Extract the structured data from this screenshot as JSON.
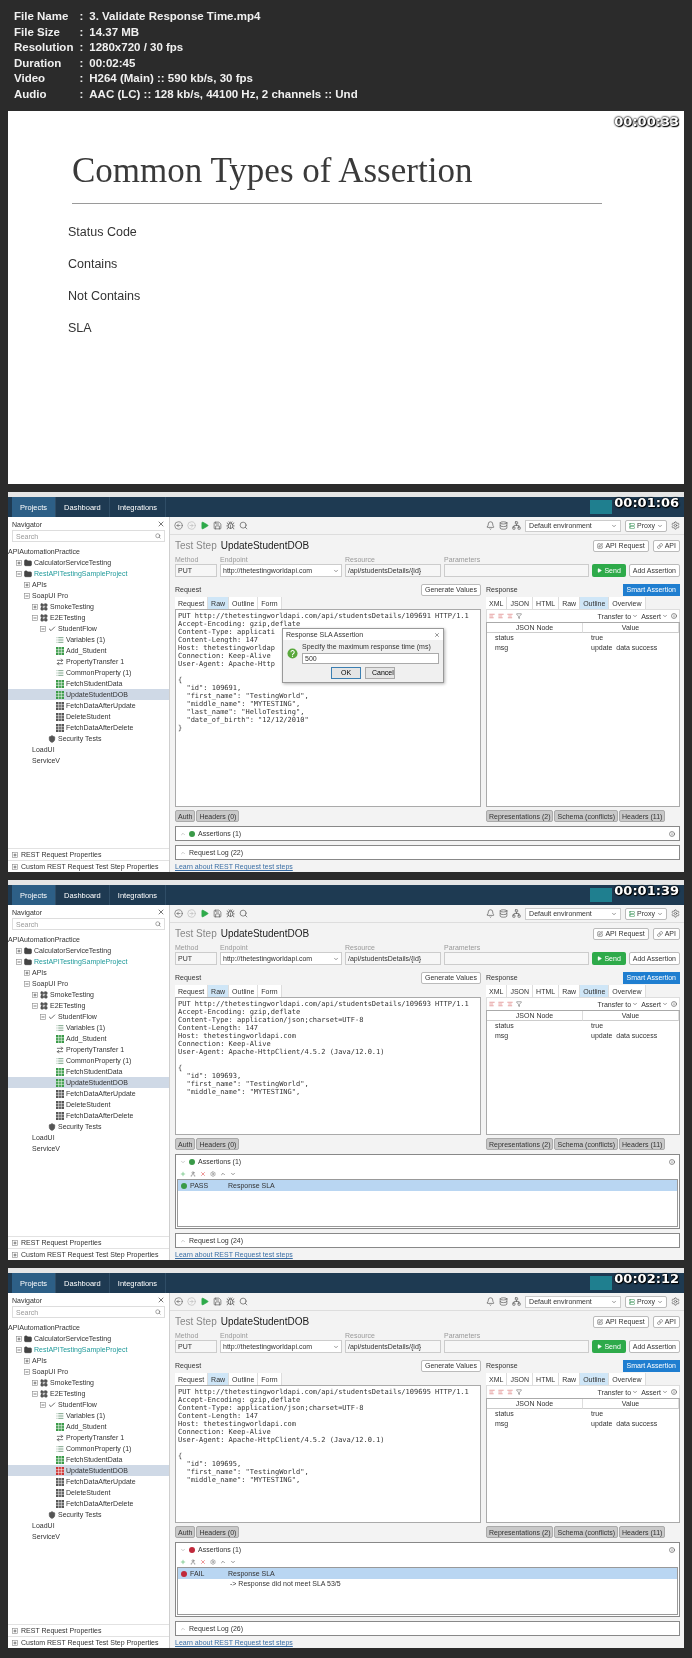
{
  "info": [
    {
      "label": "File Name",
      "sep": ":",
      "value": "3. Validate Response Time.mp4"
    },
    {
      "label": "File Size",
      "sep": ":",
      "value": "14.37 MB"
    },
    {
      "label": "Resolution",
      "sep": ":",
      "value": "1280x720 / 30 fps"
    },
    {
      "label": "Duration",
      "sep": ":",
      "value": "00:02:45"
    },
    {
      "label": "Video",
      "sep": ":",
      "value": "H264 (Main) :: 590 kb/s, 30 fps"
    },
    {
      "label": "Audio",
      "sep": ":",
      "value": "AAC (LC) :: 128 kb/s, 44100 Hz, 2 channels :: Und"
    }
  ],
  "frames": [
    {
      "kind": "slide",
      "timestamp": "00:00:33",
      "title": "Common Types of Assertion",
      "items": [
        "Status Code",
        "Contains",
        "Not Contains",
        "SLA"
      ]
    },
    {
      "kind": "app",
      "timestamp": "00:01:06",
      "tabs": [
        {
          "label": "Projects",
          "selected": true
        },
        {
          "label": "Dashboard",
          "selected": false
        },
        {
          "label": "Integrations",
          "selected": false
        }
      ],
      "navigator": {
        "title": "Navigator",
        "search_placeholder": "Search",
        "tree": [
          {
            "label": "APIAutomationPractice",
            "selected": false,
            "children": [
              {
                "label": "CalculatorServiceTesting",
                "kind": "project",
                "open": false,
                "expanded": false,
                "selected": false
              },
              {
                "label": "RestAPITestingSampleProject",
                "kind": "project",
                "open": true,
                "expanded": true,
                "selected": false,
                "children": [
                  {
                    "label": "APIs",
                    "expanded": false,
                    "selected": false
                  },
                  {
                    "label": "SoapUI Pro",
                    "expanded": true,
                    "selected": false,
                    "children": [
                      {
                        "label": "SmokeTesting",
                        "kind": "suite",
                        "expanded": false,
                        "selected": false
                      },
                      {
                        "label": "E2ETesting",
                        "kind": "suite",
                        "expanded": true,
                        "selected": false,
                        "children": [
                          {
                            "label": "StudentFlow",
                            "kind": "case",
                            "expanded": true,
                            "selected": false,
                            "children": [
                              {
                                "label": "Variables (1)",
                                "kind": "properties",
                                "selected": false
                              },
                              {
                                "label": "Add_Student",
                                "kind": "step",
                                "color": "#3a9a48",
                                "selected": false
                              },
                              {
                                "label": "PropertyTransfer 1",
                                "kind": "transfer",
                                "selected": false
                              },
                              {
                                "label": "CommonProperty (1)",
                                "kind": "properties",
                                "selected": false
                              },
                              {
                                "label": "FetchStudentData",
                                "kind": "step",
                                "color": "#3a9a48",
                                "selected": false
                              },
                              {
                                "label": "UpdateStudentDOB",
                                "kind": "step",
                                "color": "#3a9a48",
                                "selected": true
                              },
                              {
                                "label": "FetchDataAfterUpdate",
                                "kind": "step",
                                "color": "#555555",
                                "selected": false
                              },
                              {
                                "label": "DeleteStudent",
                                "kind": "step",
                                "color": "#555555",
                                "selected": false
                              },
                              {
                                "label": "FetchDataAfterDelete",
                                "kind": "step",
                                "color": "#555555",
                                "selected": false
                              }
                            ]
                          },
                          {
                            "label": "Security Tests",
                            "kind": "security",
                            "selected": false
                          }
                        ]
                      }
                    ]
                  },
                  {
                    "label": "LoadUI",
                    "selected": false
                  },
                  {
                    "label": "ServiceV",
                    "selected": false
                  }
                ]
              }
            ]
          }
        ],
        "properties": [
          {
            "label": "REST Request Properties",
            "expanded": false
          },
          {
            "label": "Custom REST Request Test Step Properties",
            "expanded": false
          }
        ]
      },
      "environment": "Default environment",
      "proxy": "Proxy",
      "step": {
        "label": "Test Step",
        "name": "UpdateStudentDOB",
        "buttons": [
          "API Request",
          "API"
        ]
      },
      "fields": [
        {
          "label": "Method",
          "value": "PUT",
          "kind": "text"
        },
        {
          "label": "Endpoint",
          "value": "http://thetestingworldapi.com",
          "kind": "select"
        },
        {
          "label": "Resource",
          "value": "/api/studentsDetails/{id}",
          "kind": "text"
        },
        {
          "label": "Parameters",
          "kind": "text"
        }
      ],
      "send": "Send",
      "add_assertion": "Add Assertion",
      "request": {
        "title": "Request",
        "generate": "Generate Values",
        "tabs": [
          {
            "label": "Request",
            "selected": false
          },
          {
            "label": "Raw",
            "selected": true
          },
          {
            "label": "Outline",
            "selected": false
          },
          {
            "label": "Form",
            "selected": false
          }
        ],
        "headers": [
          "PUT http://thetestingworldapi.com/api/studentsDetails/109691 HTTP/1.1",
          "Accept-Encoding: gzip,deflate",
          "Content-Type: applicati",
          "Content-Length: 147",
          "Host: thetestingworldap",
          "Connection: Keep-Alive",
          "User-Agent: Apache-Http"
        ],
        "body": [
          "{",
          "  \"id\": 109691,",
          "  \"first_name\": \"TestingWorld\",",
          "  \"middle_name\": \"MYTESTING\",",
          "  \"last_name\": \"HelloTesting\",",
          "  \"date_of_birth\": \"12/12/2010\"",
          "}"
        ],
        "bottom_tabs": [
          "Auth",
          "Headers (0)"
        ]
      },
      "dialog": {
        "title": "Response SLA Assertion",
        "message": "Specify the maximum response time (ms)",
        "value": "500",
        "buttons": [
          "OK",
          "Cancel"
        ]
      },
      "response": {
        "smart": "Smart Assertion",
        "title": "Response",
        "tabs": [
          {
            "label": "XML",
            "selected": false
          },
          {
            "label": "JSON",
            "selected": false
          },
          {
            "label": "HTML",
            "selected": false
          },
          {
            "label": "Raw",
            "selected": false
          },
          {
            "label": "Outline",
            "selected": true
          },
          {
            "label": "Overview",
            "selected": false
          }
        ],
        "transfer": "Transfer to",
        "assert": "Assert",
        "columns": [
          "JSON Node",
          "Value"
        ],
        "rows": [
          [
            "status",
            "true"
          ],
          [
            "msg",
            "update  data success"
          ]
        ],
        "bottom_tabs": [
          "Representations (2)",
          "Schema (conflicts)",
          "Headers (11)"
        ]
      },
      "assertions": {
        "title": "Assertions (1)",
        "expanded": false,
        "color": "#3a9a48"
      },
      "log": "Request Log (22)",
      "link": "Learn about REST Request test steps"
    },
    {
      "kind": "app",
      "timestamp": "00:01:39",
      "tabs": [
        {
          "label": "Projects",
          "selected": true
        },
        {
          "label": "Dashboard",
          "selected": false
        },
        {
          "label": "Integrations",
          "selected": false
        }
      ],
      "navigator": {
        "title": "Navigator",
        "search_placeholder": "Search",
        "tree": [
          {
            "label": "APIAutomationPractice",
            "selected": false,
            "children": [
              {
                "label": "CalculatorServiceTesting",
                "kind": "project",
                "open": false,
                "expanded": false,
                "selected": false
              },
              {
                "label": "RestAPITestingSampleProject",
                "kind": "project",
                "open": true,
                "expanded": true,
                "selected": false,
                "children": [
                  {
                    "label": "APIs",
                    "expanded": false,
                    "selected": false
                  },
                  {
                    "label": "SoapUI Pro",
                    "expanded": true,
                    "selected": false,
                    "children": [
                      {
                        "label": "SmokeTesting",
                        "kind": "suite",
                        "expanded": false,
                        "selected": false
                      },
                      {
                        "label": "E2ETesting",
                        "kind": "suite",
                        "expanded": true,
                        "selected": false,
                        "children": [
                          {
                            "label": "StudentFlow",
                            "kind": "case",
                            "expanded": true,
                            "selected": false,
                            "children": [
                              {
                                "label": "Variables (1)",
                                "kind": "properties",
                                "selected": false
                              },
                              {
                                "label": "Add_Student",
                                "kind": "step",
                                "color": "#3a9a48",
                                "selected": false
                              },
                              {
                                "label": "PropertyTransfer 1",
                                "kind": "transfer",
                                "selected": false
                              },
                              {
                                "label": "CommonProperty (1)",
                                "kind": "properties",
                                "selected": false
                              },
                              {
                                "label": "FetchStudentData",
                                "kind": "step",
                                "color": "#3a9a48",
                                "selected": false
                              },
                              {
                                "label": "UpdateStudentDOB",
                                "kind": "step",
                                "color": "#3a9a48",
                                "selected": true
                              },
                              {
                                "label": "FetchDataAfterUpdate",
                                "kind": "step",
                                "color": "#555555",
                                "selected": false
                              },
                              {
                                "label": "DeleteStudent",
                                "kind": "step",
                                "color": "#555555",
                                "selected": false
                              },
                              {
                                "label": "FetchDataAfterDelete",
                                "kind": "step",
                                "color": "#555555",
                                "selected": false
                              }
                            ]
                          },
                          {
                            "label": "Security Tests",
                            "kind": "security",
                            "selected": false
                          }
                        ]
                      }
                    ]
                  },
                  {
                    "label": "LoadUI",
                    "selected": false
                  },
                  {
                    "label": "ServiceV",
                    "selected": false
                  }
                ]
              }
            ]
          }
        ],
        "properties": [
          {
            "label": "REST Request Properties",
            "expanded": false
          },
          {
            "label": "Custom REST Request Test Step Properties",
            "expanded": false
          }
        ]
      },
      "environment": "Default environment",
      "proxy": "Proxy",
      "step": {
        "label": "Test Step",
        "name": "UpdateStudentDOB",
        "buttons": [
          "API Request",
          "API"
        ]
      },
      "fields": [
        {
          "label": "Method",
          "value": "PUT",
          "kind": "text"
        },
        {
          "label": "Endpoint",
          "value": "http://thetestingworldapi.com",
          "kind": "select"
        },
        {
          "label": "Resource",
          "value": "/api/studentsDetails/{id}",
          "kind": "text"
        },
        {
          "label": "Parameters",
          "kind": "text"
        }
      ],
      "send": "Send",
      "add_assertion": "Add Assertion",
      "request": {
        "title": "Request",
        "generate": "Generate Values",
        "tabs": [
          {
            "label": "Request",
            "selected": false
          },
          {
            "label": "Raw",
            "selected": true
          },
          {
            "label": "Outline",
            "selected": false
          },
          {
            "label": "Form",
            "selected": false
          }
        ],
        "headers": [
          "PUT http://thetestingworldapi.com/api/studentsDetails/109693 HTTP/1.1",
          "Accept-Encoding: gzip,deflate",
          "Content-Type: application/json;charset=UTF-8",
          "Content-Length: 147",
          "Host: thetestingworldapi.com",
          "Connection: Keep-Alive",
          "User-Agent: Apache-HttpClient/4.5.2 (Java/12.0.1)"
        ],
        "body": [
          "{",
          "  \"id\": 109693,",
          "  \"first_name\": \"TestingWorld\",",
          "  \"middle_name\": \"MYTESTING\","
        ],
        "bottom_tabs": [
          "Auth",
          "Headers (0)"
        ]
      },
      "response": {
        "smart": "Smart Assertion",
        "title": "Response",
        "tabs": [
          {
            "label": "XML",
            "selected": false
          },
          {
            "label": "JSON",
            "selected": false
          },
          {
            "label": "HTML",
            "selected": false
          },
          {
            "label": "Raw",
            "selected": false
          },
          {
            "label": "Outline",
            "selected": true
          },
          {
            "label": "Overview",
            "selected": false
          }
        ],
        "transfer": "Transfer to",
        "assert": "Assert",
        "columns": [
          "JSON Node",
          "Value"
        ],
        "rows": [
          [
            "status",
            "true"
          ],
          [
            "msg",
            "update  data success"
          ]
        ],
        "bottom_tabs": [
          "Representations (2)",
          "Schema (conflicts)",
          "Headers (11)"
        ]
      },
      "assertions": {
        "title": "Assertions (1)",
        "expanded": true,
        "color": "#3a9a48",
        "rows": [
          {
            "status": "PASS",
            "name": "Response SLA",
            "color": "#3a9a48",
            "selected": true
          }
        ]
      },
      "log": "Request Log (24)",
      "link": "Learn about REST Request test steps"
    },
    {
      "kind": "app",
      "timestamp": "00:02:12",
      "tabs": [
        {
          "label": "Projects",
          "selected": true
        },
        {
          "label": "Dashboard",
          "selected": false
        },
        {
          "label": "Integrations",
          "selected": false
        }
      ],
      "navigator": {
        "title": "Navigator",
        "search_placeholder": "Search",
        "tree": [
          {
            "label": "APIAutomationPractice",
            "selected": false,
            "children": [
              {
                "label": "CalculatorServiceTesting",
                "kind": "project",
                "open": false,
                "expanded": false,
                "selected": false
              },
              {
                "label": "RestAPITestingSampleProject",
                "kind": "project",
                "open": true,
                "expanded": true,
                "selected": false,
                "children": [
                  {
                    "label": "APIs",
                    "expanded": false,
                    "selected": false
                  },
                  {
                    "label": "SoapUI Pro",
                    "expanded": true,
                    "selected": false,
                    "children": [
                      {
                        "label": "SmokeTesting",
                        "kind": "suite",
                        "expanded": false,
                        "selected": false
                      },
                      {
                        "label": "E2ETesting",
                        "kind": "suite",
                        "expanded": true,
                        "selected": false,
                        "children": [
                          {
                            "label": "StudentFlow",
                            "kind": "case",
                            "expanded": true,
                            "selected": false,
                            "children": [
                              {
                                "label": "Variables (1)",
                                "kind": "properties",
                                "selected": false
                              },
                              {
                                "label": "Add_Student",
                                "kind": "step",
                                "color": "#3a9a48",
                                "selected": false
                              },
                              {
                                "label": "PropertyTransfer 1",
                                "kind": "transfer",
                                "selected": false
                              },
                              {
                                "label": "CommonProperty (1)",
                                "kind": "properties",
                                "selected": false
                              },
                              {
                                "label": "FetchStudentData",
                                "kind": "step",
                                "color": "#3a9a48",
                                "selected": false
                              },
                              {
                                "label": "UpdateStudentDOB",
                                "kind": "step",
                                "color": "#cc3333",
                                "selected": true
                              },
                              {
                                "label": "FetchDataAfterUpdate",
                                "kind": "step",
                                "color": "#555555",
                                "selected": false
                              },
                              {
                                "label": "DeleteStudent",
                                "kind": "step",
                                "color": "#555555",
                                "selected": false
                              },
                              {
                                "label": "FetchDataAfterDelete",
                                "kind": "step",
                                "color": "#555555",
                                "selected": false
                              }
                            ]
                          },
                          {
                            "label": "Security Tests",
                            "kind": "security",
                            "selected": false
                          }
                        ]
                      }
                    ]
                  },
                  {
                    "label": "LoadUI",
                    "selected": false
                  },
                  {
                    "label": "ServiceV",
                    "selected": false
                  }
                ]
              }
            ]
          }
        ],
        "properties": [
          {
            "label": "REST Request Properties",
            "expanded": false
          },
          {
            "label": "Custom REST Request Test Step Properties",
            "expanded": false
          }
        ]
      },
      "environment": "Default environment",
      "proxy": "Proxy",
      "step": {
        "label": "Test Step",
        "name": "UpdateStudentDOB",
        "buttons": [
          "API Request",
          "API"
        ]
      },
      "fields": [
        {
          "label": "Method",
          "value": "PUT",
          "kind": "text"
        },
        {
          "label": "Endpoint",
          "value": "http://thetestingworldapi.com",
          "kind": "select"
        },
        {
          "label": "Resource",
          "value": "/api/studentsDetails/{id}",
          "kind": "text"
        },
        {
          "label": "Parameters",
          "kind": "text"
        }
      ],
      "send": "Send",
      "add_assertion": "Add Assertion",
      "request": {
        "title": "Request",
        "generate": "Generate Values",
        "tabs": [
          {
            "label": "Request",
            "selected": false
          },
          {
            "label": "Raw",
            "selected": true
          },
          {
            "label": "Outline",
            "selected": false
          },
          {
            "label": "Form",
            "selected": false
          }
        ],
        "headers": [
          "PUT http://thetestingworldapi.com/api/studentsDetails/109695 HTTP/1.1",
          "Accept-Encoding: gzip,deflate",
          "Content-Type: application/json;charset=UTF-8",
          "Content-Length: 147",
          "Host: thetestingworldapi.com",
          "Connection: Keep-Alive",
          "User-Agent: Apache-HttpClient/4.5.2 (Java/12.0.1)"
        ],
        "body": [
          "{",
          "  \"id\": 109695,",
          "  \"first_name\": \"TestingWorld\",",
          "  \"middle_name\": \"MYTESTING\","
        ],
        "bottom_tabs": [
          "Auth",
          "Headers (0)"
        ]
      },
      "response": {
        "smart": "Smart Assertion",
        "title": "Response",
        "tabs": [
          {
            "label": "XML",
            "selected": false
          },
          {
            "label": "JSON",
            "selected": false
          },
          {
            "label": "HTML",
            "selected": false
          },
          {
            "label": "Raw",
            "selected": false
          },
          {
            "label": "Outline",
            "selected": true
          },
          {
            "label": "Overview",
            "selected": false
          }
        ],
        "transfer": "Transfer to",
        "assert": "Assert",
        "columns": [
          "JSON Node",
          "Value"
        ],
        "rows": [
          [
            "status",
            "true"
          ],
          [
            "msg",
            "update  data success"
          ]
        ],
        "bottom_tabs": [
          "Representations (2)",
          "Schema (conflicts)",
          "Headers (11)"
        ]
      },
      "assertions": {
        "title": "Assertions (1)",
        "expanded": true,
        "color": "#c0293b",
        "rows": [
          {
            "status": "FAIL",
            "name": "Response SLA",
            "detail": "-> Response did not meet SLA 53/5",
            "color": "#c0293b",
            "selected": true
          }
        ]
      },
      "log": "Request Log (26)",
      "link": "Learn about REST Request test steps"
    }
  ]
}
